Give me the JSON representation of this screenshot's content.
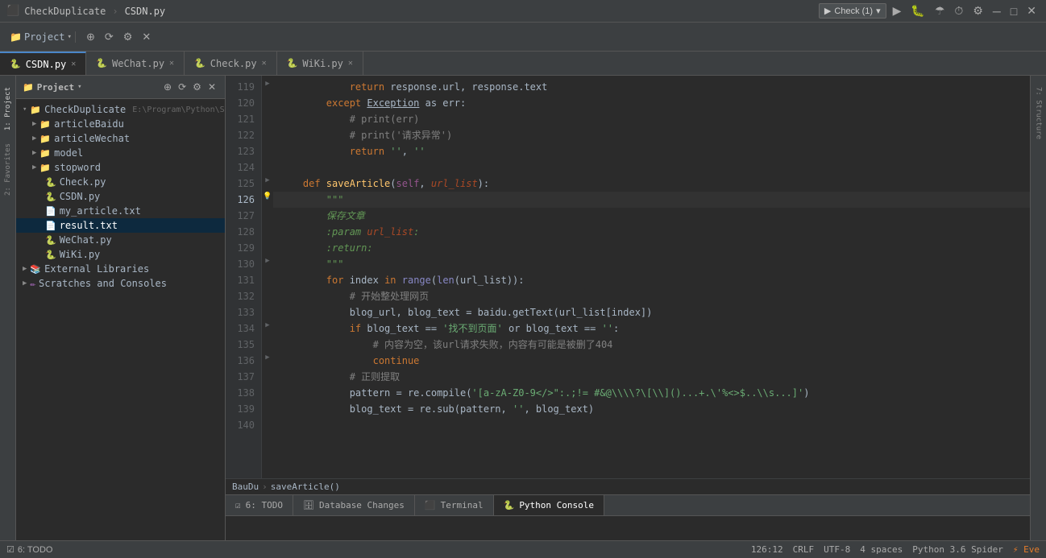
{
  "titlebar": {
    "app": "CheckDuplicate",
    "separator": "›",
    "file": "CSDN.py",
    "check_btn": "Check (1)",
    "run_icon": "▶",
    "debug_icon": "🐛",
    "coverage_icon": "☂",
    "profile_icon": "⏱",
    "tools_icon": "⚙"
  },
  "toolbar": {
    "project_label": "Project",
    "add_icon": "+",
    "sync_icon": "⟳",
    "settings_icon": "⚙",
    "close_icon": "✕"
  },
  "tabs": [
    {
      "id": "csdn",
      "icon": "🐍",
      "label": "CSDN.py",
      "active": true,
      "closable": true
    },
    {
      "id": "wechat",
      "icon": "🐍",
      "label": "WeChat.py",
      "active": false,
      "closable": true
    },
    {
      "id": "check",
      "icon": "🐍",
      "label": "Check.py",
      "active": false,
      "closable": true
    },
    {
      "id": "wiki",
      "icon": "🐍",
      "label": "WiKi.py",
      "active": false,
      "closable": true
    }
  ],
  "sidebar": {
    "title": "Project",
    "root": {
      "name": "CheckDuplicate",
      "path": "E:\\Program\\Python\\Spider\\C..."
    },
    "items": [
      {
        "id": "articleBaidu",
        "label": "articleBaidu",
        "type": "folder",
        "indent": 1,
        "expanded": false
      },
      {
        "id": "articleWechat",
        "label": "articleWechat",
        "type": "folder",
        "indent": 1,
        "expanded": false
      },
      {
        "id": "model",
        "label": "model",
        "type": "folder",
        "indent": 1,
        "expanded": false
      },
      {
        "id": "stopword",
        "label": "stopword",
        "type": "folder",
        "indent": 1,
        "expanded": false
      },
      {
        "id": "checkpy",
        "label": "Check.py",
        "type": "py",
        "indent": 1
      },
      {
        "id": "csdnpy",
        "label": "CSDN.py",
        "type": "py",
        "indent": 1
      },
      {
        "id": "myarticle",
        "label": "my_article.txt",
        "type": "txt",
        "indent": 1
      },
      {
        "id": "result",
        "label": "result.txt",
        "type": "txt",
        "indent": 1,
        "selected": true
      },
      {
        "id": "wechatpy",
        "label": "WeChat.py",
        "type": "py",
        "indent": 1
      },
      {
        "id": "wikiPy",
        "label": "WiKi.py",
        "type": "py",
        "indent": 1
      },
      {
        "id": "extLibs",
        "label": "External Libraries",
        "type": "lib",
        "indent": 0
      },
      {
        "id": "scratches",
        "label": "Scratches and Consoles",
        "type": "scratch",
        "indent": 0
      }
    ]
  },
  "editor": {
    "lines": [
      {
        "num": 119,
        "active": false,
        "gutter": "fold",
        "content": "            return response.url, response.text"
      },
      {
        "num": 120,
        "active": false,
        "gutter": "",
        "content": "        except Exception as err:"
      },
      {
        "num": 121,
        "active": false,
        "gutter": "",
        "content": "            # print(err)"
      },
      {
        "num": 122,
        "active": false,
        "gutter": "",
        "content": "            # print('请求异常')"
      },
      {
        "num": 123,
        "active": false,
        "gutter": "",
        "content": "            return '', ''"
      },
      {
        "num": 124,
        "active": false,
        "gutter": "",
        "content": ""
      },
      {
        "num": 125,
        "active": false,
        "gutter": "fold",
        "content": "    def saveArticle(self, url_list):"
      },
      {
        "num": 126,
        "active": true,
        "gutter": "bulb",
        "content": "        \"\"\""
      },
      {
        "num": 127,
        "active": false,
        "gutter": "",
        "content": "        保存文章"
      },
      {
        "num": 128,
        "active": false,
        "gutter": "",
        "content": "        :param url_list:"
      },
      {
        "num": 129,
        "active": false,
        "gutter": "",
        "content": "        :return:"
      },
      {
        "num": 130,
        "active": false,
        "gutter": "fold",
        "content": "        \"\"\""
      },
      {
        "num": 131,
        "active": false,
        "gutter": "",
        "content": "        for index in range(len(url_list)):"
      },
      {
        "num": 132,
        "active": false,
        "gutter": "",
        "content": "            # 开始整处理网页"
      },
      {
        "num": 133,
        "active": false,
        "gutter": "",
        "content": "            blog_url, blog_text = baidu.getText(url_list[index])"
      },
      {
        "num": 134,
        "active": false,
        "gutter": "fold",
        "content": "            if blog_text == '找不到页面' or blog_text == '':"
      },
      {
        "num": 135,
        "active": false,
        "gutter": "",
        "content": "                # 内容为空，该url请求失败，内容有可能是被删了404"
      },
      {
        "num": 136,
        "active": false,
        "gutter": "fold",
        "content": "                continue"
      },
      {
        "num": 137,
        "active": false,
        "gutter": "",
        "content": "            # 正则提取"
      },
      {
        "num": 138,
        "active": false,
        "gutter": "",
        "content": "            pattern = re.compile('[a-zA-Z0-9</>\":;.!= #&@\\\\?\\[\\]()...+.\\'%<>$..\\s...])"
      },
      {
        "num": 139,
        "active": false,
        "gutter": "",
        "content": "            blog_text = re.sub(pattern, '', blog_text)"
      },
      {
        "num": 140,
        "active": false,
        "gutter": "",
        "content": ""
      }
    ]
  },
  "breadcrumb": {
    "items": [
      "BauDu",
      "saveArticle()"
    ]
  },
  "bottom_tabs": [
    {
      "id": "todo",
      "label": "6: TODO",
      "icon": "☑",
      "active": false
    },
    {
      "id": "dbchanges",
      "label": "Database Changes",
      "icon": "🗄",
      "active": false
    },
    {
      "id": "terminal",
      "label": "Terminal",
      "icon": "⬛",
      "active": false
    },
    {
      "id": "pyconsole",
      "label": "Python Console",
      "icon": "🐍",
      "active": true
    }
  ],
  "statusbar": {
    "line_col": "126:12",
    "crlf": "CRLF",
    "encoding": "UTF-8",
    "indent": "4 spaces",
    "python": "Python 3.6 Spider",
    "events": "⚡ Eve"
  },
  "outer_tabs": {
    "left": [
      {
        "id": "project",
        "label": "1: Project",
        "active": true
      },
      {
        "id": "favorites",
        "label": "2: Favorites",
        "active": false
      }
    ],
    "right": [
      {
        "id": "structure",
        "label": "7: Structure",
        "active": false
      }
    ]
  }
}
